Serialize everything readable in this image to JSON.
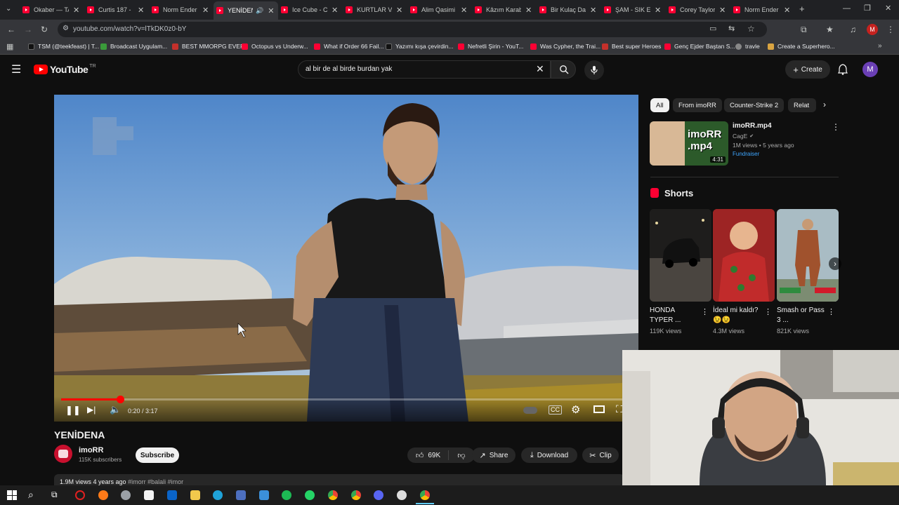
{
  "browser": {
    "tabs": [
      {
        "title": "Okaber — TA"
      },
      {
        "title": "Curtis 187 -"
      },
      {
        "title": "Norm Ender"
      },
      {
        "title": "YENİDEN",
        "active": true
      },
      {
        "title": "Ice Cube - C"
      },
      {
        "title": "KURTLAR VA"
      },
      {
        "title": "Alim Qasimi"
      },
      {
        "title": "Kâzım Karab"
      },
      {
        "title": "Bir Kulaç Dal"
      },
      {
        "title": "ŞAM - SIK E"
      },
      {
        "title": "Corey Taylor"
      },
      {
        "title": "Norm Ender"
      }
    ],
    "url": "youtube.com/watch?v=lTkDK0z0-bY",
    "profile_initial": "M",
    "bookmarks": [
      {
        "label": "TSM (@teekfeast) | T...",
        "color": "#000000"
      },
      {
        "label": "Broadcast Uygulam...",
        "color": "#3a9b3a"
      },
      {
        "label": "BEST MMORPG EVER",
        "color": "#c4302b"
      },
      {
        "label": "Octopus vs Underw...",
        "color": "#ff0033"
      },
      {
        "label": "What if Order 66 Fail...",
        "color": "#ff0033"
      },
      {
        "label": "Yazımı kışa çevirdin...",
        "color": "#000000"
      },
      {
        "label": "Nefretli Şirin - YouT...",
        "color": "#ff0033"
      },
      {
        "label": "Was Cypher, the Trai...",
        "color": "#ff0033"
      },
      {
        "label": "Best super Heroes",
        "color": "#c4302b"
      },
      {
        "label": "Genç Ejder Baştan S...",
        "color": "#ff0033"
      },
      {
        "label": "travle",
        "color": "#888888"
      },
      {
        "label": "Create a Superhero...",
        "color": "#d9a441"
      }
    ]
  },
  "youtube": {
    "logo_text": "YouTube",
    "logo_region": "TR",
    "search_query": "al bir de al birde burdan yak",
    "create_label": "Create",
    "avatar_initial": "M"
  },
  "player": {
    "time_current": "0:20",
    "time_total": "3:17",
    "progress_fraction": 0.104
  },
  "video": {
    "title": "YENİDENA",
    "channel": "imoRR",
    "subscribers": "115K subscribers",
    "subscribe_label": "Subscribe",
    "likes": "69K",
    "share_label": "Share",
    "download_label": "Download",
    "clip_label": "Clip",
    "views_date": "1.9M views  4 years ago",
    "tags": "#imorr #balali #imor"
  },
  "sidebar": {
    "chips": [
      "All",
      "From imoRR",
      "Counter-Strike 2",
      "Relat"
    ],
    "recommended": {
      "title": "imoRR.mp4",
      "channel": "CagE",
      "meta": "1M views • 5 years ago",
      "badge": "Fundraiser",
      "duration": "4:31",
      "thumb_text": "imoRR .mp4"
    },
    "shorts_heading": "Shorts",
    "shorts": [
      {
        "title": "HONDA TYPER ...",
        "views": "119K views"
      },
      {
        "title": "İdeal mi kaldı? 😉😉",
        "views": "4.3M views"
      },
      {
        "title": "Smash or Pass 3 ...",
        "views": "821K views"
      }
    ]
  }
}
